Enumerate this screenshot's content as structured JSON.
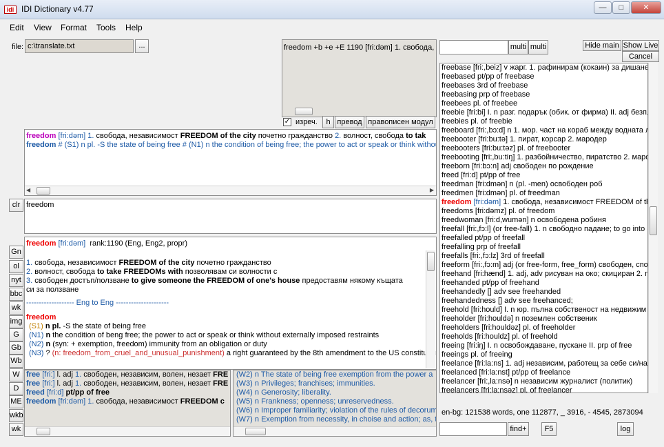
{
  "window": {
    "title": "IDI Dictionary v4.77",
    "app_icon": "idi"
  },
  "menu": [
    "Edit",
    "View",
    "Format",
    "Tools",
    "Help"
  ],
  "file": {
    "label": "file:",
    "value": "c:\\translate.txt",
    "browse": "..."
  },
  "top_preview": "freedom +b +e +E 1190 [fri:dəm] 1. свобода, н",
  "options": {
    "checkbox_label": "изреч.",
    "checked": true,
    "btn_h": "h",
    "btn_translate": "превод",
    "btn_spell": "правописен модул"
  },
  "search": {
    "value": "",
    "multi1": "multi",
    "multi2": "multi"
  },
  "right_buttons": {
    "hide_main": "Hide main",
    "show_live": "Show Live",
    "cancel": "Cancel"
  },
  "summary_panel": {
    "line1": {
      "word": "freedom",
      "pron": "[fri:dəm]",
      "n1": "1.",
      "t1": "свобода, независимост",
      "b1": "FREEDOM of the city",
      "t2": "почетно гражданство",
      "n2": "2.",
      "t3": "волност, свобода",
      "b2": "to tak"
    },
    "line2": {
      "word": "freedom",
      "rest": "# (S1) n pl. -S the state of being free # (N1) n the condition of being free; the power to act or speak or think without e"
    }
  },
  "clr": "clr",
  "word_input": "freedom",
  "side_buttons": [
    "Gn",
    "ol",
    "nyt",
    "bbc",
    "wk",
    "img",
    "G",
    "Gb",
    "Wb",
    "W",
    "D",
    "ME",
    "wkb",
    "wk"
  ],
  "main_entry": {
    "header_word": "freedom",
    "header_pron": "[fri:dəm]",
    "header_rank": "rank:1190  (Eng, Eng2, propr)",
    "s1_num": "1.",
    "s1_t1": "свобода, независимост",
    "s1_b": "FREEDOM of the city",
    "s1_t2": "почетно гражданство",
    "s2_num": "2.",
    "s2_t1": "волност, свобода",
    "s2_b": "to take FREEDOMs with",
    "s2_t2": "позволявам си волности с",
    "s3_num": "3.",
    "s3_t1": "свободен достъп/ползване",
    "s3_b": "to give someone the FREEDOM of one's house",
    "s3_t2": "предоставям някому къщата",
    "s3_cont": "си за ползване",
    "divider": "------------------- Eng to Eng ---------------------",
    "eng_word": "freedom",
    "e1_tag": "(S1)",
    "e1_b": "n pl.",
    "e1_t": "-S the state of being free",
    "e2_tag": "(N1)",
    "e2_b": "n",
    "e2_t": "the condition of beng free; the power to act or speak or think without externally imposed restraints",
    "e3_tag": "(N2)",
    "e3_b": "n",
    "e3_t": "(syn: + exemption, freedom) immunity from an obligation or duty",
    "e4_tag": "(N3)",
    "e4_q": "?",
    "e4_syn": "(n: freedom_from_cruel_and_unusual_punishment)",
    "e4_t": "a right guaranteed by the 8th amendment to the US constitution"
  },
  "bottom_left": [
    {
      "w": "free",
      "p": "[fri:]",
      "t": "l. adj",
      "n": "1.",
      "bg": "свободен, независим, волен, незает",
      "tail": "FRE"
    },
    {
      "w": "free",
      "p": "[fri:]",
      "t": "l. adj",
      "n": "1.",
      "bg": "свободен, независим, волен, незает",
      "tail": "FRE"
    },
    {
      "w": "freed",
      "p": "[fri:d]",
      "t": "pt/pp of free",
      "n": "",
      "bg": "",
      "tail": ""
    },
    {
      "w": "freedom",
      "p": "[fri:dəm]",
      "t": "",
      "n": "1.",
      "bg": "свобода, независимост",
      "tail": "FREEDOM c"
    }
  ],
  "bottom_mid": [
    {
      "tag": "(W2)",
      "t": "n The state of being free  exemption from the power a"
    },
    {
      "tag": "(W3)",
      "t": "n Privileges; franchises; immunities."
    },
    {
      "tag": "(W4)",
      "t": "n Generosity; liberality."
    },
    {
      "tag": "(W5)",
      "t": "n Frankness; openness; unreservedness."
    },
    {
      "tag": "(W6)",
      "t": "n Improper familiarity; violation of the rules of decorum"
    },
    {
      "tag": "(W7)",
      "t": "n Exemption from necessity, in choise and action; as, t"
    }
  ],
  "word_list": [
    "freebase [fri:,beiz] v жарг. 1. рафинирам (кокаин) за дишане",
    "freebased pt/pp of freebase",
    "freebases 3rd of freebase",
    "freebasing prp of freebase",
    "freebees pl. of freebee",
    "freebie [fri:bi] I. n разг. подарък (обик. от фирма) II. adj безпл",
    "freebies pl. of freebie",
    "freeboard [fri:,bɔ:d] n 1. мор. част на кораб между водната л",
    "freebooter [fri:bu:tə] 1. пират, корсар 2. мародер",
    "freebooters [fri:bu:təz] pl. of freebooter",
    "freebooting [fri:,bu:tiŋ] 1. разбойничество, пиратство 2. маро",
    "freeborn [fri:bɔ:n] adj свободен по рождение",
    "freed [fri:d] pt/pp of free",
    "freedman [fri:dmən] n (pl. -men) освободен роб",
    "freedmen [fri:dmən] pl. of freedman",
    "@freedom [fri:dəm] 1. свобода, независимост FREEDOM of th",
    "freedoms [fri:dəmz] pl. of freedom",
    "freedwoman [fri:d,wumən] n освободена робиня",
    "freefall [fri:,fɔ:l] (or free-fall) 1. n свободно падане; to go into (do",
    "freefalled pt/pp of freefall",
    "freefalling prp of freefall",
    "freefalls [fri:,fɔ:lz] 3rd of freefall",
    "freeform [fri:,fɔ:m] adj (or free-form, free_form) свободен, спонт",
    "freehand [fri:hænd] 1. adj, adv рисуван на око; скициран 2. n",
    "freehanded pt/pp of freehand",
    "freehandedly [] adv see freehanded",
    "freehandedness [] adv see freehanced;",
    "freehold [fri:hould] I. n юр. пълна собственост на недвижим",
    "freeholder [fri:houldə] n поземлен собственик",
    "freeholders [fri:houldəz] pl. of freeholder",
    "freeholds [fri:houldz] pl. of freehold",
    "freeing [fri:iŋ] I. n освобождаване, пускане II. prp of free",
    "freeings pl. of freeing",
    "freelance [fri:la:ns] 1. adj независим, работещ за себе си/на",
    "freelanced [fri:la:nst] pt/pp of freelance",
    "freelancer [fri:,la:nsə] n независим журналист (политик)",
    "freelancers [fri:la:nsəz] pl. of freelancer"
  ],
  "status": "en-bg: 121538 words, one 112877, _ 3916, - 4545, 2873094",
  "bottom_buttons": {
    "find": "find+",
    "f5": "F5",
    "log": "log"
  }
}
